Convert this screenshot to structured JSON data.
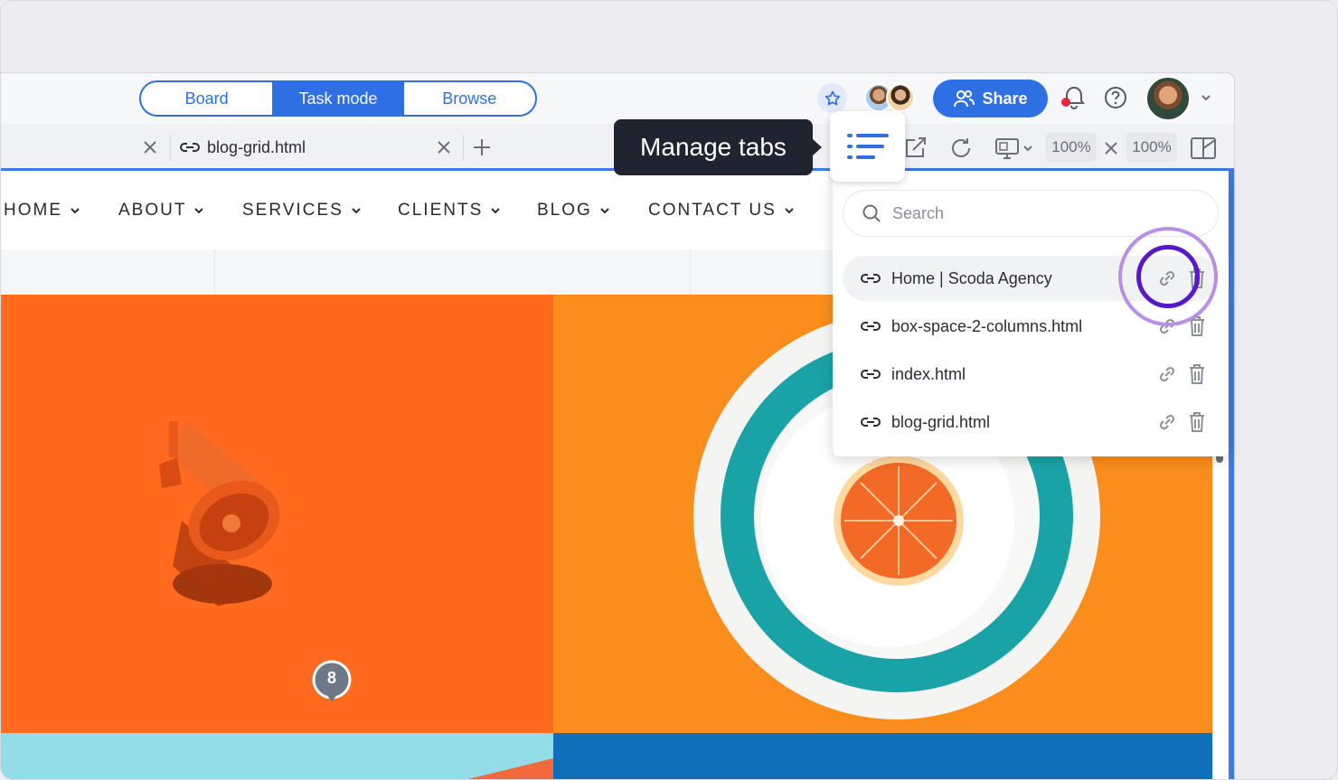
{
  "header": {
    "modes": [
      "Board",
      "Task mode",
      "Browse"
    ],
    "active_mode": "Task mode",
    "share_label": "Share"
  },
  "tabs": {
    "open_tab_label": "blog-grid.html"
  },
  "toolbar": {
    "zoom_width": "100%",
    "zoom_height": "100%"
  },
  "tooltip": {
    "label": "Manage tabs"
  },
  "site": {
    "nav": [
      "HOME",
      "ABOUT",
      "SERVICES",
      "CLIENTS",
      "BLOG",
      "CONTACT US"
    ],
    "comment_count": "8"
  },
  "tab_manager": {
    "search_placeholder": "Search",
    "items": [
      "Home | Scoda Agency",
      "box-space-2-columns.html",
      "index.html",
      "blog-grid.html"
    ]
  },
  "colors": {
    "accent": "#2f6fe4",
    "highlight_ring": "#5a17c8",
    "notification_dot": "#e5253a"
  }
}
